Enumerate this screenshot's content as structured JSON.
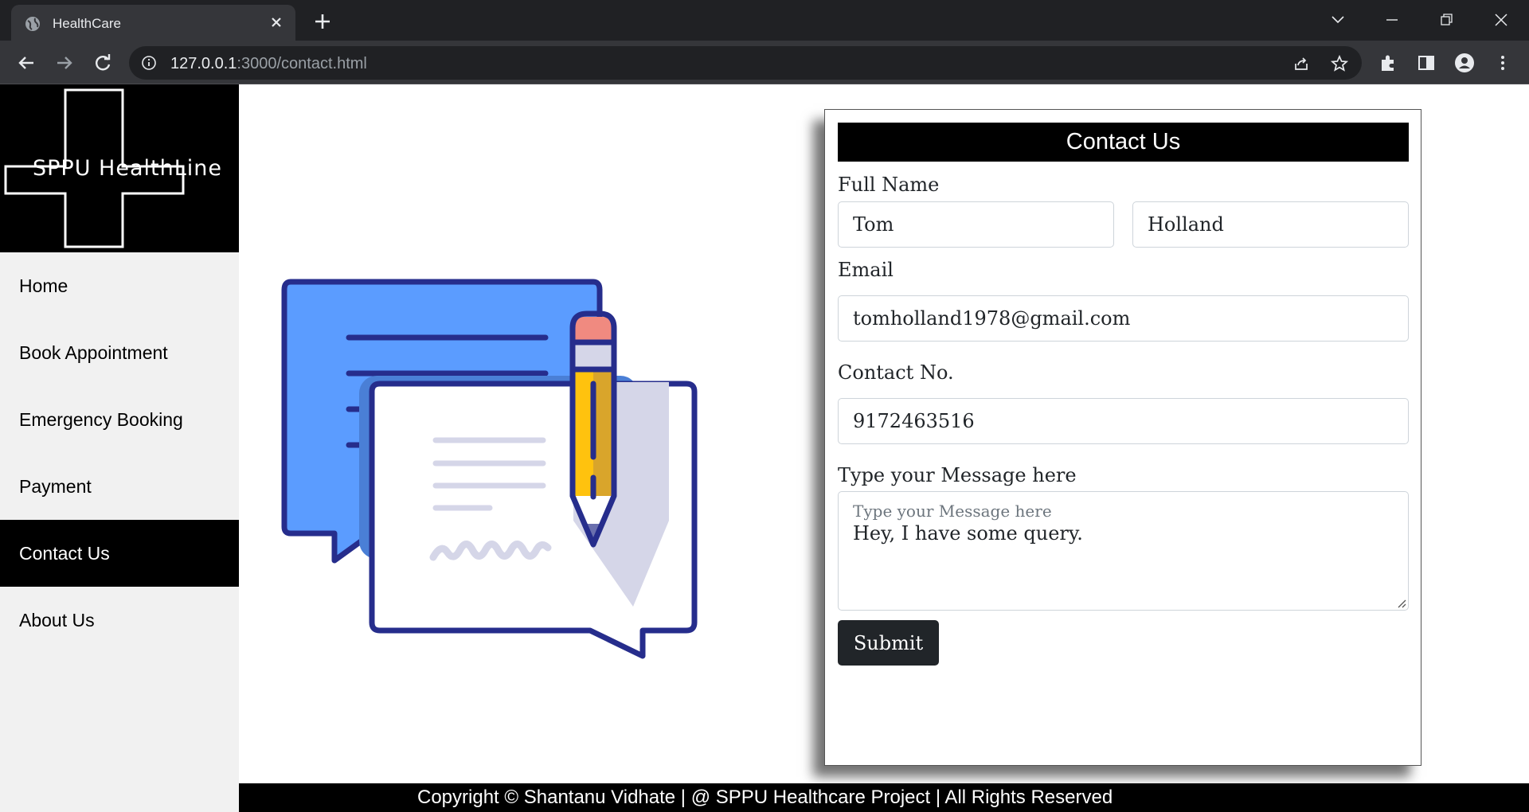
{
  "browser": {
    "tab_title": "HealthCare",
    "url_host": "127.0.0.1",
    "url_rest": ":3000/contact.html"
  },
  "sidebar": {
    "logo_text": "SPPU HealthLine",
    "items": [
      {
        "label": "Home"
      },
      {
        "label": "Book Appointment"
      },
      {
        "label": "Emergency Booking"
      },
      {
        "label": "Payment"
      },
      {
        "label": "Contact Us",
        "active": true
      },
      {
        "label": "About Us"
      }
    ]
  },
  "form": {
    "title": "Contact Us",
    "full_name_label": "Full Name",
    "first_name_value": "Tom",
    "last_name_value": "Holland",
    "email_label": "Email",
    "email_value": "tomholland1978@gmail.com",
    "contact_label": "Contact No.",
    "contact_value": "9172463516",
    "message_label": "Type your Message here",
    "message_placeholder": "Type your Message here",
    "message_value": "Hey, I have some query.",
    "submit_label": "Submit"
  },
  "footer": {
    "text": "Copyright © Shantanu Vidhate | @ SPPU Healthcare Project | All Rights Reserved"
  },
  "colors": {
    "chrome_dark": "#202124",
    "chrome_toolbar": "#35363a",
    "sidebar_bg": "#f1f1f1",
    "active_nav": "#000000",
    "illustration_blue": "#5b9cff",
    "illustration_navy": "#262d8c",
    "pencil_yellow": "#ffc20e",
    "eraser_pink": "#f08a80"
  },
  "icons": [
    "globe-icon",
    "close-icon",
    "plus-icon",
    "chevron-down-icon",
    "minimize-icon",
    "restore-icon",
    "window-close-icon",
    "back-arrow-icon",
    "forward-arrow-icon",
    "reload-icon",
    "info-icon",
    "share-icon",
    "star-icon",
    "extensions-icon",
    "side-panel-icon",
    "profile-icon",
    "kebab-menu-icon"
  ]
}
